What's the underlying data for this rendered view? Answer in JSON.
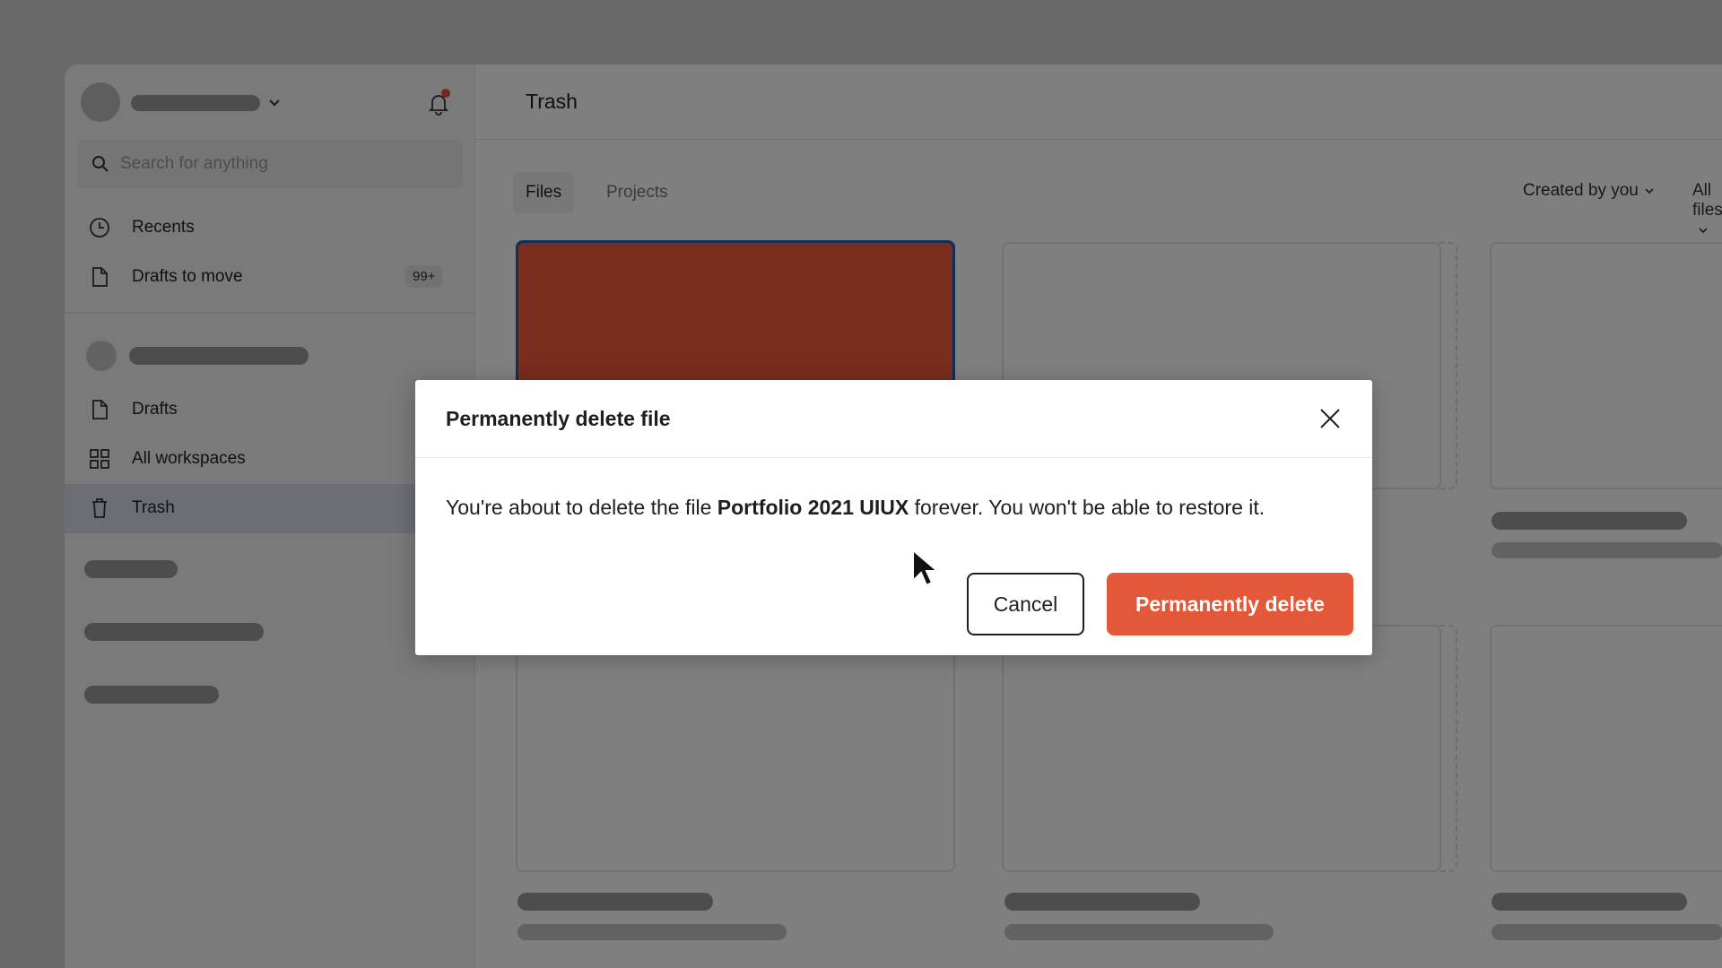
{
  "sidebar": {
    "search_placeholder": "Search for anything",
    "items": [
      {
        "label": "Recents",
        "icon": "clock-icon"
      },
      {
        "label": "Drafts to move",
        "icon": "file-icon",
        "badge": "99+"
      },
      {
        "label": "Drafts",
        "icon": "file-icon"
      },
      {
        "label": "All workspaces",
        "icon": "grid-icon"
      },
      {
        "label": "Trash",
        "icon": "trash-icon",
        "active": true
      }
    ]
  },
  "header": {
    "title": "Trash"
  },
  "tabs": [
    {
      "label": "Files",
      "active": true
    },
    {
      "label": "Projects",
      "active": false
    }
  ],
  "filters": {
    "owner": "Created by you",
    "scope": "All files"
  },
  "modal": {
    "title": "Permanently delete file",
    "message_prefix": "You're about to delete the file ",
    "file_name": "Portfolio 2021 UIUX",
    "message_suffix": " forever. You won't be able to restore it.",
    "cancel_label": "Cancel",
    "delete_label": "Permanently delete"
  },
  "colors": {
    "accent_danger": "#e4583a",
    "selection_border": "#1a5fb4",
    "active_nav": "#d6dfea",
    "notification_dot": "#e0553a"
  }
}
